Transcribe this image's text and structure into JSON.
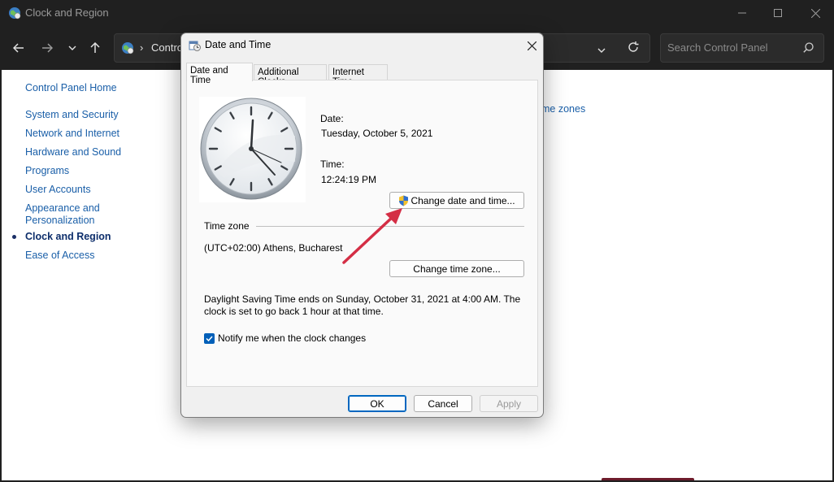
{
  "window": {
    "title": "Clock and Region",
    "breadcrumb": "Control",
    "search_placeholder": "Search Control Panel"
  },
  "sidebar": {
    "items": [
      {
        "label": "Control Panel Home"
      },
      {
        "label": "System and Security"
      },
      {
        "label": "Network and Internet"
      },
      {
        "label": "Hardware and Sound"
      },
      {
        "label": "Programs"
      },
      {
        "label": "User Accounts"
      },
      {
        "label": "Appearance and Personalization"
      },
      {
        "label": "Clock and Region",
        "current": true
      },
      {
        "label": "Ease of Access"
      }
    ]
  },
  "background_link": "me zones",
  "dialog": {
    "title": "Date and Time",
    "tabs": [
      "Date and Time",
      "Additional Clocks",
      "Internet Time"
    ],
    "active_tab": "Date and Time",
    "date_label": "Date:",
    "date_value": "Tuesday, October 5, 2021",
    "time_label": "Time:",
    "time_value": "12:24:19 PM",
    "change_datetime_button": "Change date and time...",
    "timezone_heading": "Time zone",
    "timezone_value": "(UTC+02:00) Athens, Bucharest",
    "change_timezone_button": "Change time zone...",
    "dst_line1": "Daylight Saving Time ends on Sunday, October 31, 2021 at 4:00 AM. The",
    "dst_line2": "clock is set to go back 1 hour at that time.",
    "notify_label": "Notify me when the clock changes",
    "notify_checked": true,
    "ok_button": "OK",
    "cancel_button": "Cancel",
    "apply_button": "Apply"
  },
  "colors": {
    "link": "#1a5fa8",
    "accent": "#0067c0",
    "annotation_arrow": "#d42e45"
  },
  "icons": {
    "app": "globe-clock-icon",
    "minimize": "minimize-icon",
    "maximize": "maximize-icon",
    "close": "close-icon",
    "back": "back-arrow-icon",
    "forward": "forward-arrow-icon",
    "recent": "chevron-down-icon",
    "up": "up-arrow-icon",
    "refresh": "refresh-icon",
    "search": "search-icon",
    "uac": "uac-shield-icon"
  }
}
